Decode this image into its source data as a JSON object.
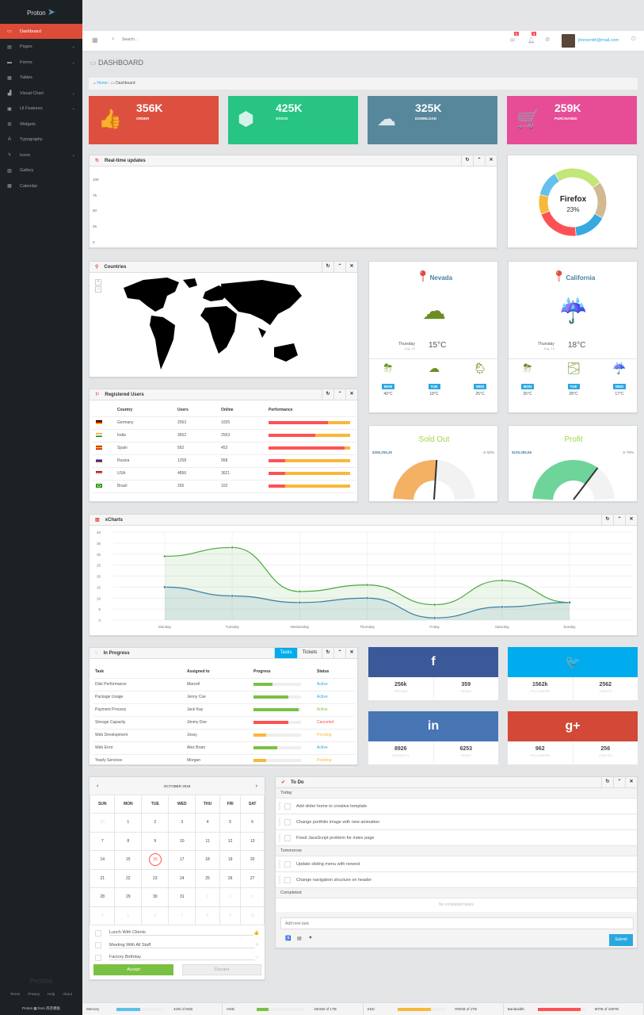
{
  "sidebar": {
    "logo": "Proton",
    "items": [
      {
        "label": "Dashboard",
        "icon": "laptop-icon",
        "glyph": "▭",
        "active": true,
        "chevron": false
      },
      {
        "label": "Pages",
        "icon": "file-icon",
        "glyph": "▤",
        "chevron": true
      },
      {
        "label": "Forms",
        "icon": "form-icon",
        "glyph": "▬",
        "chevron": true
      },
      {
        "label": "Tables",
        "icon": "table-icon",
        "glyph": "▦",
        "chevron": false
      },
      {
        "label": "Visual Chart",
        "icon": "chart-icon",
        "glyph": "▟",
        "chevron": true
      },
      {
        "label": "UI Features",
        "icon": "briefcase-icon",
        "glyph": "▣",
        "chevron": true
      },
      {
        "label": "Widgets",
        "icon": "lifebuoy-icon",
        "glyph": "◍",
        "chevron": false
      },
      {
        "label": "Typography",
        "icon": "font-icon",
        "glyph": "A",
        "chevron": false
      },
      {
        "label": "Icons",
        "icon": "bolt-icon",
        "glyph": "ϟ",
        "chevron": true
      },
      {
        "label": "Gallery",
        "icon": "image-icon",
        "glyph": "▨",
        "chevron": false
      },
      {
        "label": "Calendar",
        "icon": "calendar-icon",
        "glyph": "▦",
        "chevron": false
      }
    ],
    "footer_logo": "Proton",
    "links": [
      "Terms",
      "Privacy",
      "Help",
      "About"
    ],
    "credit": "Proton ▦ from 风宗模板"
  },
  "topbar": {
    "search_placeholder": "Search...",
    "mail_count": "5",
    "notif_count": "3",
    "user_email": "jhonsmith@mail.com"
  },
  "page": {
    "title": "DASHBOARD",
    "breadcrumb": [
      "Home",
      "Dashboard"
    ]
  },
  "stats": [
    {
      "value": "356K",
      "label": "ORDER",
      "color": "#dd5040",
      "icon": "thumbs-up-icon",
      "glyph": "👍"
    },
    {
      "value": "425K",
      "label": "STOCK",
      "color": "#27c484",
      "icon": "cubes-icon",
      "glyph": "⬢"
    },
    {
      "value": "325K",
      "label": "DOWNLOAD",
      "color": "#56879b",
      "icon": "cloud-download-icon",
      "glyph": "☁"
    },
    {
      "value": "259K",
      "label": "PURCHASED",
      "color": "#e64d96",
      "icon": "cart-icon",
      "glyph": "🛒"
    }
  ],
  "realtime": {
    "title": "Real-time updates",
    "yticks": [
      "100",
      "75",
      "50",
      "25",
      "0"
    ]
  },
  "donut": {
    "label": "Firefox",
    "value": "23%",
    "segments": [
      {
        "share": 23,
        "color": "#c1e776"
      },
      {
        "share": 17,
        "color": "#d2b992"
      },
      {
        "share": 15,
        "color": "#37a8e0"
      },
      {
        "share": 20,
        "color": "#fd5254"
      },
      {
        "share": 9,
        "color": "#f8b83a"
      },
      {
        "share": 12,
        "color": "#65c0ee"
      }
    ]
  },
  "countries": {
    "title": "Countries",
    "zoom_in": "+",
    "zoom_out": "−"
  },
  "weather": [
    {
      "city": "Nevada",
      "day": "Thursday",
      "date": "July, 19",
      "temp": "15°C",
      "icon": "cloud-moon-snow-icon",
      "glyph": "☁",
      "forecast": [
        {
          "day": "MON",
          "temp": "40°C",
          "icon": "thunderstorm-sun-icon",
          "glyph": "⛈"
        },
        {
          "day": "TUE",
          "temp": "18°C",
          "icon": "cloud-moon-snow-icon",
          "glyph": "☁"
        },
        {
          "day": "WED",
          "temp": "25°C",
          "icon": "rain-sun-icon",
          "glyph": "🌦"
        }
      ]
    },
    {
      "city": "California",
      "day": "Thursday",
      "date": "July, 19",
      "temp": "18°C",
      "icon": "cloud-rain-icon",
      "glyph": "☔",
      "forecast": [
        {
          "day": "MON",
          "temp": "35°C",
          "icon": "thunderstorm-sun-icon",
          "glyph": "⛈"
        },
        {
          "day": "TUE",
          "temp": "28°C",
          "icon": "fog-sun-icon",
          "glyph": "🌫"
        },
        {
          "day": "WED",
          "temp": "17°C",
          "icon": "cloud-rain-icon",
          "glyph": "☔"
        }
      ]
    }
  ],
  "users": {
    "title": "Registered Users",
    "headers": [
      "Country",
      "Users",
      "Online",
      "Performance"
    ],
    "rows": [
      {
        "flag": "germany",
        "country": "Germany",
        "users": "2563",
        "online": "1025",
        "perf": 73
      },
      {
        "flag": "india",
        "country": "India",
        "users": "3652",
        "online": "2563",
        "perf": 57
      },
      {
        "flag": "spain",
        "country": "Spain",
        "users": "562",
        "online": "452",
        "perf": 93
      },
      {
        "flag": "russia",
        "country": "Russia",
        "users": "1258",
        "online": "958",
        "perf": 20
      },
      {
        "flag": "usa",
        "country": "USA",
        "users": "4856",
        "online": "3621",
        "perf": 20
      },
      {
        "flag": "brazil",
        "country": "Brazil",
        "users": "265",
        "online": "102",
        "perf": 20
      }
    ]
  },
  "gauges": [
    {
      "title": "Sold Out",
      "amount": "$256,256,25",
      "percent": "52%",
      "value": 52,
      "color": "#f4b063"
    },
    {
      "title": "Profit",
      "amount": "$125,365,56",
      "percent": "70%",
      "value": 70,
      "color": "#6ed49a"
    }
  ],
  "chart_data": {
    "type": "area",
    "title": "xCharts",
    "categories": [
      "Monday",
      "Tuesday",
      "Wednesday",
      "Thursday",
      "Friday",
      "Saturday",
      "Sunday"
    ],
    "ylim": [
      0,
      40
    ],
    "yticks": [
      0,
      5,
      10,
      15,
      20,
      25,
      30,
      35,
      40
    ],
    "grid": true,
    "series": [
      {
        "values": [
          29,
          33,
          13,
          16,
          7,
          18,
          8
        ],
        "color": "#4aa83f"
      },
      {
        "values": [
          15,
          11,
          8,
          10,
          1,
          6,
          8
        ],
        "color": "#3a7f9f"
      }
    ]
  },
  "progress": {
    "title": "In Progress",
    "tabs": [
      "Tasks",
      "Tickets"
    ],
    "headers": [
      "Task",
      "Assigned to",
      "Progress",
      "Status"
    ],
    "rows": [
      {
        "task": "Disk Performance",
        "who": "Marcell",
        "progress": 40,
        "color": "#7ac143",
        "status": "Active",
        "scolor": "#29a8e0"
      },
      {
        "task": "Package Usage",
        "who": "Jenny Coe",
        "progress": 73,
        "color": "#7ac143",
        "status": "Active",
        "scolor": "#29a8e0"
      },
      {
        "task": "Payment Process",
        "who": "Jack Kay",
        "progress": 95,
        "color": "#7ac143",
        "status": "Active",
        "scolor": "#7ac143"
      },
      {
        "task": "Storage Capacity",
        "who": "Jimmy Doe",
        "progress": 73,
        "color": "#fd5254",
        "status": "Canceled",
        "scolor": "#fd5254"
      },
      {
        "task": "Web Development",
        "who": "Jossy",
        "progress": 27,
        "color": "#f8b83a",
        "status": "Pending",
        "scolor": "#f8b83a"
      },
      {
        "task": "Web Error",
        "who": "Alex Bram",
        "progress": 50,
        "color": "#7ac143",
        "status": "Active",
        "scolor": "#29a8e0"
      },
      {
        "task": "Yearly Services",
        "who": "Morgan",
        "progress": 27,
        "color": "#f8b83a",
        "status": "Pending",
        "scolor": "#f8b83a"
      }
    ]
  },
  "social": [
    {
      "name": "facebook",
      "glyph": "f",
      "color": "#3b5998",
      "a": "256k",
      "al": "FRIENDS",
      "b": "359",
      "bl": "FEEDS"
    },
    {
      "name": "twitter",
      "glyph": "🐦",
      "color": "#00aced",
      "a": "1562k",
      "al": "FOLLOWERS",
      "b": "2562",
      "bl": "TWEETS"
    },
    {
      "name": "linkedin",
      "glyph": "in",
      "color": "#4875b4",
      "a": "8926",
      "al": "CONTACTS",
      "b": "6253",
      "bl": "FEEDS"
    },
    {
      "name": "google-plus",
      "glyph": "g+",
      "color": "#d34836",
      "a": "962",
      "al": "FOLLOWERS",
      "b": "256",
      "bl": "CIRCLES"
    }
  ],
  "calendar": {
    "month": "OCTOBER 2018",
    "weekdays": [
      "SUN",
      "MON",
      "TUE",
      "WED",
      "THU",
      "FRI",
      "SAT"
    ],
    "today": "16",
    "weeks": [
      [
        "30",
        "1",
        "2",
        "3",
        "4",
        "5",
        "6"
      ],
      [
        "7",
        "8",
        "9",
        "10",
        "11",
        "12",
        "13"
      ],
      [
        "14",
        "15",
        "16",
        "17",
        "18",
        "19",
        "20"
      ],
      [
        "21",
        "22",
        "23",
        "24",
        "25",
        "26",
        "27"
      ],
      [
        "28",
        "29",
        "30",
        "31",
        "1",
        "2",
        "3"
      ],
      [
        "4",
        "5",
        "6",
        "7",
        "8",
        "9",
        "10"
      ]
    ],
    "events": [
      {
        "label": "Lunch With Clients",
        "icon": "thumbs-up-icon",
        "glyph": "👍"
      },
      {
        "label": "Meeting With All Staff",
        "icon": "plane-icon",
        "glyph": "✈"
      },
      {
        "label": "Factory Birthday",
        "icon": "star-icon",
        "glyph": "☆"
      }
    ],
    "accept": "Accept",
    "discard": "Discard"
  },
  "todo": {
    "title": "To Do",
    "sections": [
      {
        "name": "Today",
        "items": [
          "Add slider home to creative template",
          "Change portfolio image with new animation",
          "Fixed JavaScript problem for index page"
        ]
      },
      {
        "name": "Tommorow",
        "items": [
          "Update sliding menu with newest",
          "Change navigation structure on header"
        ]
      }
    ],
    "completed": "Completed",
    "empty": "No completed tasks",
    "placeholder": "Add new task",
    "submit": "Submit"
  },
  "footer": [
    {
      "label": "Memory",
      "value": "4GB of 8GB",
      "pct": 50,
      "color": "#5bc0eb"
    },
    {
      "label": "HDD",
      "value": "250GB of 1TB",
      "pct": 25,
      "color": "#7ac143"
    },
    {
      "label": "SSD",
      "value": "700GB of 1TB",
      "pct": 70,
      "color": "#f8b83a"
    },
    {
      "label": "Bandwidth",
      "value": "90TB of 100TB",
      "pct": 90,
      "color": "#fd5254"
    }
  ]
}
